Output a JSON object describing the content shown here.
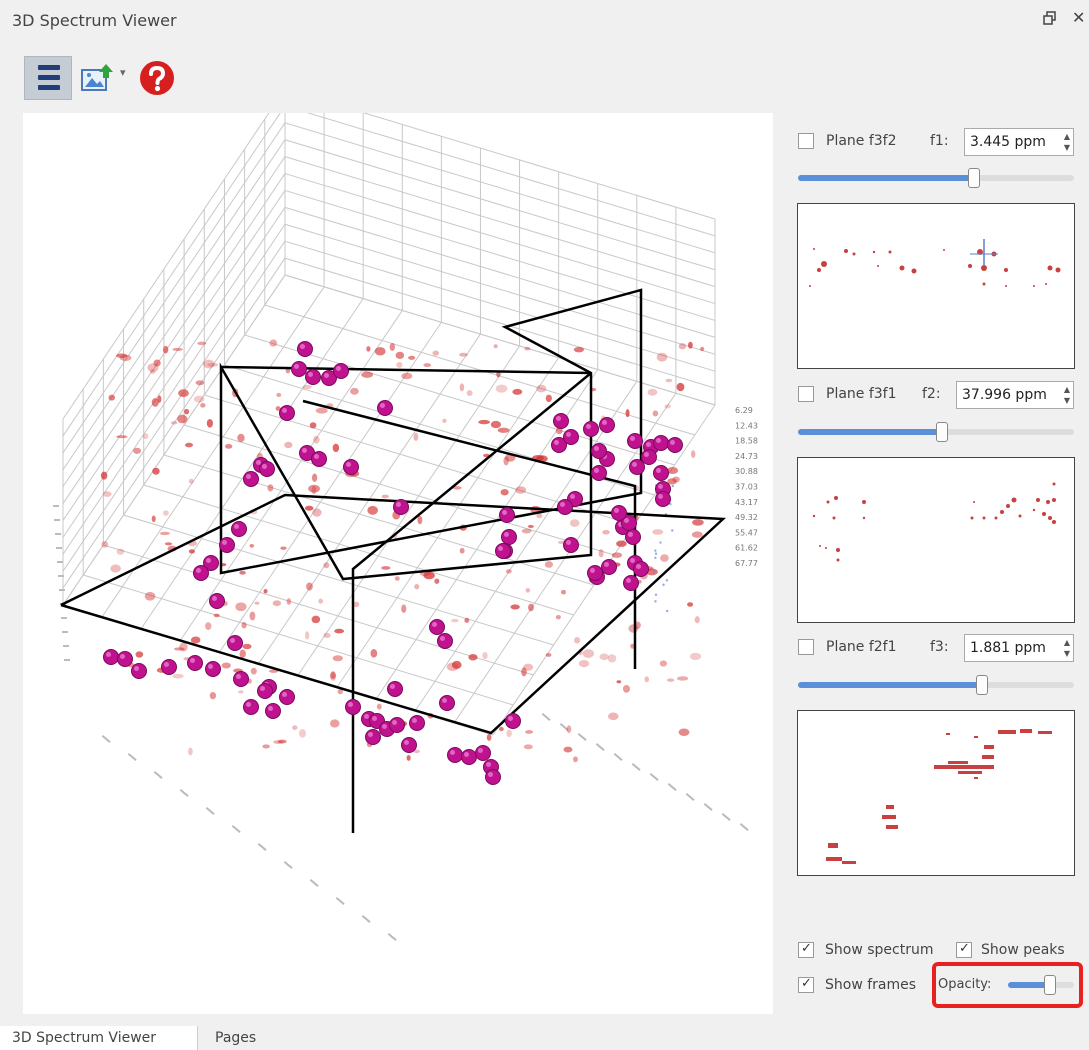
{
  "window": {
    "title": "3D Spectrum Viewer"
  },
  "toolbar": {
    "menu_icon": "hamburger-icon",
    "export_icon": "export-image-icon",
    "help_icon": "help-icon"
  },
  "axes3d": {
    "right_ticks": [
      "6.29",
      "12.43",
      "18.58",
      "24.73",
      "30.88",
      "37.03",
      "43.17",
      "49.32",
      "55.47",
      "61.62",
      "67.77"
    ]
  },
  "planes": [
    {
      "label": "Plane f3f2",
      "checked": false,
      "field": "f1:",
      "value": "3.445 ppm",
      "slider_fraction": 0.63
    },
    {
      "label": "Plane f3f1",
      "checked": false,
      "field": "f2:",
      "value": "37.996 ppm",
      "slider_fraction": 0.52
    },
    {
      "label": "Plane f2f1",
      "checked": false,
      "field": "f3:",
      "value": "1.881 ppm",
      "slider_fraction": 0.66
    }
  ],
  "options": {
    "show_spectrum": {
      "label": "Show spectrum",
      "checked": true
    },
    "show_peaks": {
      "label": "Show peaks",
      "checked": true
    },
    "show_frames": {
      "label": "Show frames",
      "checked": true
    },
    "opacity": {
      "label": "Opacity:",
      "fraction": 0.72
    }
  },
  "tabs": [
    "3D Spectrum Viewer",
    "Pages"
  ],
  "colors": {
    "peak": "#c0128f",
    "spectrum": "#d33030",
    "slider": "#5b8fd8",
    "highlight": "#e8201f"
  }
}
